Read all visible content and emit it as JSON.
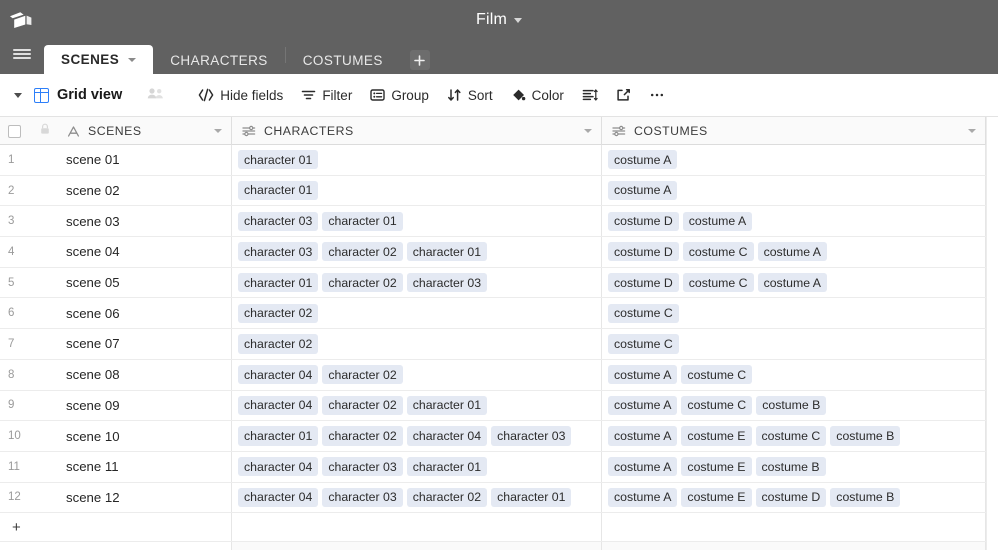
{
  "topbar": {
    "logo_icon": "cube-logo-icon",
    "title": "Film",
    "title_caret_icon": "chevron-down-icon"
  },
  "tabbar": {
    "menu_icon": "hamburger-menu-icon",
    "add_tab_label": "+",
    "tabs": [
      {
        "label": "SCENES",
        "active": true,
        "caret_icon": "chevron-down-icon"
      },
      {
        "label": "CHARACTERS",
        "active": false
      },
      {
        "label": "COSTUMES",
        "active": false
      }
    ]
  },
  "toolbar": {
    "view_caret_icon": "chevron-down-icon",
    "view_type_icon": "grid-view-icon",
    "view_name": "Grid view",
    "collaborators_icon": "collaborators-icon",
    "items": [
      {
        "label": "Hide fields",
        "icon": "hide-fields-icon"
      },
      {
        "label": "Filter",
        "icon": "filter-icon"
      },
      {
        "label": "Group",
        "icon": "group-icon"
      },
      {
        "label": "Sort",
        "icon": "sort-icon"
      },
      {
        "label": "Color",
        "icon": "color-icon"
      }
    ],
    "row_height_icon": "row-height-icon",
    "share_icon": "share-export-icon",
    "more_icon": "more-options-icon"
  },
  "grid": {
    "select_all_icon": "checkbox-icon",
    "lock_icon": "lock-icon",
    "columns": [
      {
        "name": "SCENES",
        "icon": "text-field-icon",
        "caret_icon": "chevron-down-icon"
      },
      {
        "name": "CHARACTERS",
        "icon": "linked-record-icon",
        "caret_icon": "chevron-down-icon"
      },
      {
        "name": "COSTUMES",
        "icon": "linked-record-icon",
        "caret_icon": "chevron-down-icon"
      }
    ],
    "add_row_label": "+",
    "rows": [
      {
        "num": "1",
        "scene": "scene 01",
        "characters": [
          "character 01"
        ],
        "costumes": [
          "costume A"
        ]
      },
      {
        "num": "2",
        "scene": "scene 02",
        "characters": [
          "character 01"
        ],
        "costumes": [
          "costume A"
        ]
      },
      {
        "num": "3",
        "scene": "scene 03",
        "characters": [
          "character 03",
          "character 01"
        ],
        "costumes": [
          "costume D",
          "costume A"
        ]
      },
      {
        "num": "4",
        "scene": "scene 04",
        "characters": [
          "character 03",
          "character 02",
          "character 01"
        ],
        "costumes": [
          "costume D",
          "costume C",
          "costume A"
        ]
      },
      {
        "num": "5",
        "scene": "scene 05",
        "characters": [
          "character 01",
          "character 02",
          "character 03"
        ],
        "costumes": [
          "costume D",
          "costume C",
          "costume A"
        ]
      },
      {
        "num": "6",
        "scene": "scene 06",
        "characters": [
          "character 02"
        ],
        "costumes": [
          "costume C"
        ]
      },
      {
        "num": "7",
        "scene": "scene 07",
        "characters": [
          "character 02"
        ],
        "costumes": [
          "costume C"
        ]
      },
      {
        "num": "8",
        "scene": "scene 08",
        "characters": [
          "character 04",
          "character 02"
        ],
        "costumes": [
          "costume A",
          "costume C"
        ]
      },
      {
        "num": "9",
        "scene": "scene 09",
        "characters": [
          "character 04",
          "character 02",
          "character 01"
        ],
        "costumes": [
          "costume A",
          "costume C",
          "costume B"
        ]
      },
      {
        "num": "10",
        "scene": "scene 10",
        "characters": [
          "character 01",
          "character 02",
          "character 04",
          "character 03"
        ],
        "costumes": [
          "costume A",
          "costume E",
          "costume C",
          "costume B"
        ]
      },
      {
        "num": "11",
        "scene": "scene 11",
        "characters": [
          "character 04",
          "character 03",
          "character 01"
        ],
        "costumes": [
          "costume A",
          "costume E",
          "costume B"
        ]
      },
      {
        "num": "12",
        "scene": "scene 12",
        "characters": [
          "character 04",
          "character 03",
          "character 02",
          "character 01"
        ],
        "costumes": [
          "costume A",
          "costume E",
          "costume D",
          "costume B"
        ]
      }
    ]
  },
  "colors": {
    "topbar_bg": "#616161",
    "chip_bg": "#e4e9f3",
    "accent_blue": "#2d7ff9",
    "header_bg": "#fafafa"
  }
}
